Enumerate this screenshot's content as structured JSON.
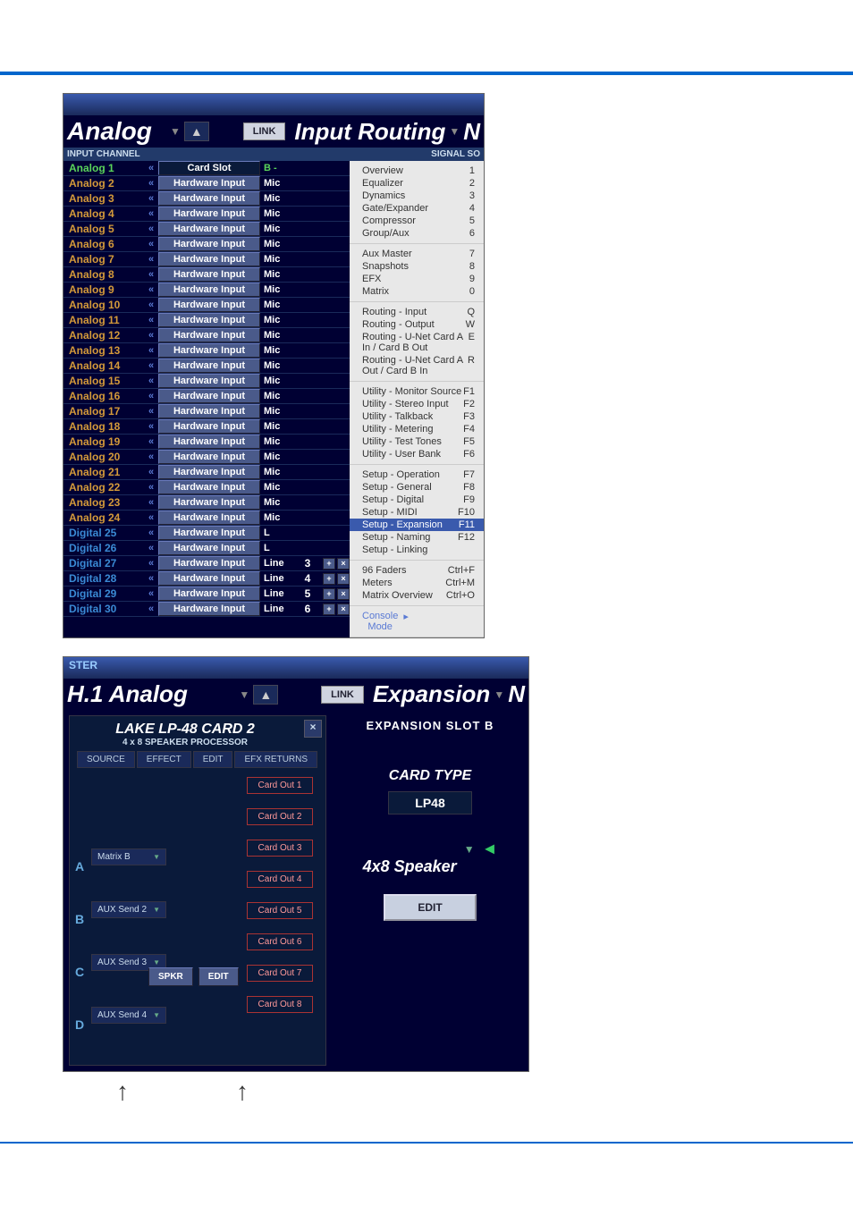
{
  "shot1": {
    "title": "Analog",
    "link": "LINK",
    "routeTitle": "Input Routing",
    "col1": "INPUT CHANNEL",
    "col2": "SIGNAL SO",
    "rows": [
      {
        "ch": "Analog 1",
        "cls": "sel",
        "btn": "Card Slot",
        "bcls": "cs",
        "sig": "B -",
        "scls": "b"
      },
      {
        "ch": "Analog 2",
        "btn": "Hardware Input",
        "sig": "Mic"
      },
      {
        "ch": "Analog 3",
        "btn": "Hardware Input",
        "sig": "Mic"
      },
      {
        "ch": "Analog 4",
        "btn": "Hardware Input",
        "sig": "Mic"
      },
      {
        "ch": "Analog 5",
        "btn": "Hardware Input",
        "sig": "Mic"
      },
      {
        "ch": "Analog 6",
        "btn": "Hardware Input",
        "sig": "Mic"
      },
      {
        "ch": "Analog 7",
        "btn": "Hardware Input",
        "sig": "Mic"
      },
      {
        "ch": "Analog 8",
        "btn": "Hardware Input",
        "sig": "Mic"
      },
      {
        "ch": "Analog 9",
        "btn": "Hardware Input",
        "sig": "Mic"
      },
      {
        "ch": "Analog 10",
        "btn": "Hardware Input",
        "sig": "Mic"
      },
      {
        "ch": "Analog 11",
        "btn": "Hardware Input",
        "sig": "Mic"
      },
      {
        "ch": "Analog 12",
        "btn": "Hardware Input",
        "sig": "Mic"
      },
      {
        "ch": "Analog 13",
        "btn": "Hardware Input",
        "sig": "Mic"
      },
      {
        "ch": "Analog 14",
        "btn": "Hardware Input",
        "sig": "Mic"
      },
      {
        "ch": "Analog 15",
        "btn": "Hardware Input",
        "sig": "Mic"
      },
      {
        "ch": "Analog 16",
        "btn": "Hardware Input",
        "sig": "Mic"
      },
      {
        "ch": "Analog 17",
        "btn": "Hardware Input",
        "sig": "Mic"
      },
      {
        "ch": "Analog 18",
        "btn": "Hardware Input",
        "sig": "Mic"
      },
      {
        "ch": "Analog 19",
        "btn": "Hardware Input",
        "sig": "Mic"
      },
      {
        "ch": "Analog 20",
        "btn": "Hardware Input",
        "sig": "Mic"
      },
      {
        "ch": "Analog 21",
        "btn": "Hardware Input",
        "sig": "Mic"
      },
      {
        "ch": "Analog 22",
        "btn": "Hardware Input",
        "sig": "Mic"
      },
      {
        "ch": "Analog 23",
        "btn": "Hardware Input",
        "sig": "Mic"
      },
      {
        "ch": "Analog 24",
        "btn": "Hardware Input",
        "sig": "Mic"
      },
      {
        "ch": "Digital 25",
        "cls": "dig",
        "btn": "Hardware Input",
        "sig": "L"
      },
      {
        "ch": "Digital 26",
        "cls": "dig",
        "btn": "Hardware Input",
        "sig": "L"
      },
      {
        "ch": "Digital 27",
        "cls": "dig",
        "btn": "Hardware Input",
        "sig": "Line",
        "num": "3"
      },
      {
        "ch": "Digital 28",
        "cls": "dig",
        "btn": "Hardware Input",
        "sig": "Line",
        "num": "4"
      },
      {
        "ch": "Digital 29",
        "cls": "dig",
        "btn": "Hardware Input",
        "sig": "Line",
        "num": "5"
      },
      {
        "ch": "Digital 30",
        "cls": "dig",
        "btn": "Hardware Input",
        "sig": "Line",
        "num": "6"
      }
    ],
    "menu": [
      [
        {
          "l": "Overview",
          "k": "1"
        },
        {
          "l": "Equalizer",
          "k": "2"
        },
        {
          "l": "Dynamics",
          "k": "3"
        },
        {
          "l": "Gate/Expander",
          "k": "4"
        },
        {
          "l": "Compressor",
          "k": "5"
        },
        {
          "l": "Group/Aux",
          "k": "6"
        }
      ],
      [
        {
          "l": "Aux Master",
          "k": "7"
        },
        {
          "l": "Snapshots",
          "k": "8"
        },
        {
          "l": "EFX",
          "k": "9"
        },
        {
          "l": "Matrix",
          "k": "0"
        }
      ],
      [
        {
          "l": "Routing - Input",
          "k": "Q"
        },
        {
          "l": "Routing - Output",
          "k": "W"
        },
        {
          "l": "Routing - U-Net Card A In / Card B Out",
          "k": "E"
        },
        {
          "l": "Routing - U-Net Card A Out / Card B In",
          "k": "R"
        }
      ],
      [
        {
          "l": "Utility - Monitor Source",
          "k": "F1"
        },
        {
          "l": "Utility - Stereo Input",
          "k": "F2"
        },
        {
          "l": "Utility - Talkback",
          "k": "F3"
        },
        {
          "l": "Utility - Metering",
          "k": "F4"
        },
        {
          "l": "Utility - Test Tones",
          "k": "F5"
        },
        {
          "l": "Utility - User Bank",
          "k": "F6"
        }
      ],
      [
        {
          "l": "Setup - Operation",
          "k": "F7"
        },
        {
          "l": "Setup - General",
          "k": "F8"
        },
        {
          "l": "Setup - Digital",
          "k": "F9"
        },
        {
          "l": "Setup - MIDI",
          "k": "F10"
        },
        {
          "l": "Setup - Expansion",
          "k": "F11",
          "hl": true
        },
        {
          "l": "Setup - Naming",
          "k": "F12"
        },
        {
          "l": "Setup - Linking",
          "k": ""
        }
      ],
      [
        {
          "l": "96 Faders",
          "k": "Ctrl+F"
        },
        {
          "l": "Meters",
          "k": "Ctrl+M"
        },
        {
          "l": "Matrix Overview",
          "k": "Ctrl+O"
        }
      ],
      [
        {
          "l": "Console Mode",
          "k": "",
          "arr": true
        }
      ]
    ]
  },
  "shot2": {
    "bar": "STER",
    "title": "H.1 Analog",
    "link": "LINK",
    "routeTitle": "Expansion",
    "expHdr": "EXPANSION SLOT B",
    "cardTitle": "LAKE  LP-48 CARD 2",
    "cardSub": "4 x 8 SPEAKER PROCESSOR",
    "close": "×",
    "tabs": [
      "SOURCE",
      "EFFECT",
      "EDIT",
      "EFX RETURNS"
    ],
    "sources": [
      {
        "id": "A",
        "label": "Matrix B"
      },
      {
        "id": "B",
        "label": "AUX Send 2"
      },
      {
        "id": "C",
        "label": "AUX Send 3"
      },
      {
        "id": "D",
        "label": "AUX Send 4"
      }
    ],
    "spkr": "SPKR",
    "edit": "EDIT",
    "outs": [
      "Card Out 1",
      "Card Out 2",
      "Card Out 3",
      "Card Out 4",
      "Card Out 5",
      "Card Out 6",
      "Card Out 7",
      "Card Out 8"
    ],
    "ctype": "CARD TYPE",
    "cval": "LP48",
    "spk": "4x8 Speaker",
    "editBtn": "EDIT"
  }
}
